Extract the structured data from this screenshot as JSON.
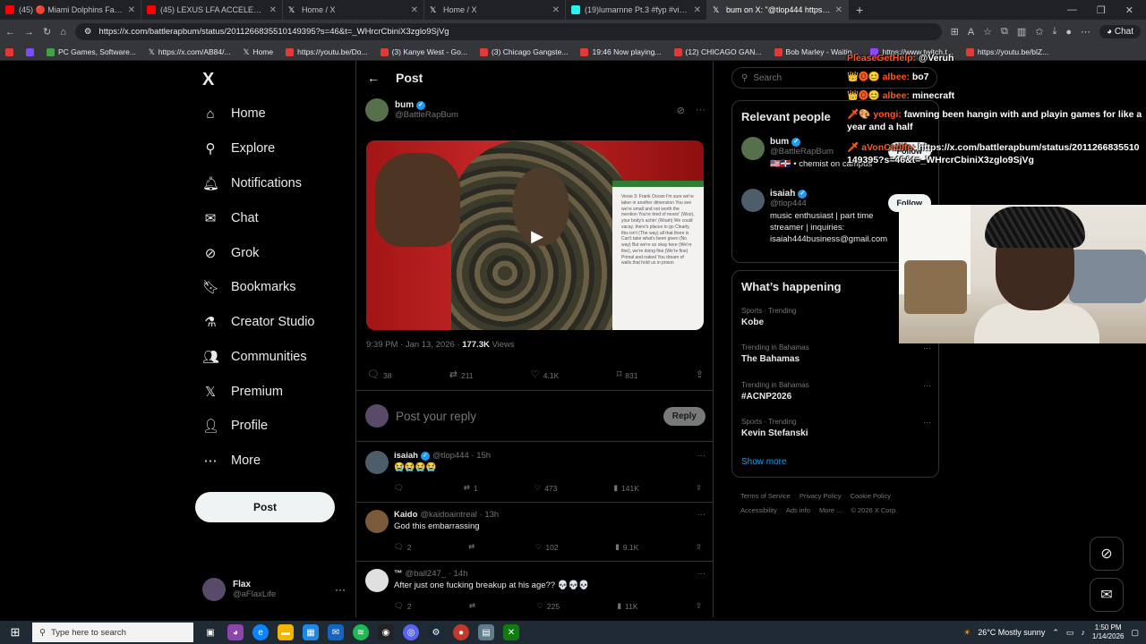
{
  "browser": {
    "tabs": [
      {
        "title": "(45) 🔴 Miami Dolphins Fans Get",
        "icon_color": "#ff0000",
        "active": false
      },
      {
        "title": "(45) LEXUS LFA ACCELERATION !!",
        "icon_color": "#ff0000",
        "active": false
      },
      {
        "title": "Home / X",
        "icon_color": "#ffffff",
        "active": false
      },
      {
        "title": "Home / X",
        "icon_color": "#ffffff",
        "active": false
      },
      {
        "title": "(19)lumarnne Pt.3 #fyp #viral #jun",
        "icon_color": "#25f4ee",
        "active": false
      },
      {
        "title": "bum on X: \"@tlop444 https://t.co",
        "icon_color": "#ffffff",
        "active": true
      }
    ],
    "url": "https://x.com/battlerapbum/status/2011266835510149395?s=46&t=_WHrcrCbiniX3zglo9SjVg",
    "chat_label": "Chat",
    "bookmarks": [
      {
        "label": "",
        "icon_color": "#e53935"
      },
      {
        "label": "",
        "icon_color": "#7c4dff"
      },
      {
        "label": "PC Games, Software...",
        "icon_color": "#43a047"
      },
      {
        "label": "https://x.com/AB84/...",
        "icon_color": "#000000"
      },
      {
        "label": "Home",
        "icon_color": "#000000"
      },
      {
        "label": "https://youtu.be/Do...",
        "icon_color": "#e53935"
      },
      {
        "label": "(3) Kanye West - Go...",
        "icon_color": "#e53935"
      },
      {
        "label": "(3) Chicago Gangste...",
        "icon_color": "#e53935"
      },
      {
        "label": "19:46 Now playing...",
        "icon_color": "#e53935"
      },
      {
        "label": "(12) CHICAGO GAN...",
        "icon_color": "#e53935"
      },
      {
        "label": "Bob Marley - Waitin...",
        "icon_color": "#e53935"
      },
      {
        "label": "https://www.twitch.t...",
        "icon_color": "#9146ff"
      },
      {
        "label": "https://youtu.be/blZ...",
        "icon_color": "#e53935"
      }
    ]
  },
  "sidebar": {
    "logo": "X",
    "nav": [
      {
        "label": "Home",
        "icon": "home-icon",
        "glyph": "⌂"
      },
      {
        "label": "Explore",
        "icon": "search-icon",
        "glyph": "⚲"
      },
      {
        "label": "Notifications",
        "icon": "bell-icon",
        "glyph": "🔔︎"
      },
      {
        "label": "Chat",
        "icon": "mail-icon",
        "glyph": "✉"
      },
      {
        "label": "Grok",
        "icon": "grok-icon",
        "glyph": "⊘"
      },
      {
        "label": "Bookmarks",
        "icon": "bookmark-icon",
        "glyph": "🔖︎"
      },
      {
        "label": "Creator Studio",
        "icon": "flask-icon",
        "glyph": "⚗"
      },
      {
        "label": "Communities",
        "icon": "people-icon",
        "glyph": "👥︎"
      },
      {
        "label": "Premium",
        "icon": "x-premium-icon",
        "glyph": "𝕏"
      },
      {
        "label": "Profile",
        "icon": "person-icon",
        "glyph": "👤︎"
      },
      {
        "label": "More",
        "icon": "more-circle-icon",
        "glyph": "⋯"
      }
    ],
    "post_label": "Post",
    "account": {
      "name": "Flax",
      "handle": "@aFlaxLife"
    }
  },
  "main": {
    "header_title": "Post",
    "author": {
      "name": "bum",
      "handle": "@BattleRapBum"
    },
    "video_text": "Verse 3: Frank Ocean I'm sure we're taker in another dimension You see we're small and not worth the mention You're tired of movin' (Woo), your body's achin' (Woah) We could vacay, there's places to go Clearly, this isn't (The way) all that there is Can't take what's been given (No way) But we're so okay here (We're fine), we're doing fine (We're fine) Primal and naked You dream of walls that hold us in prison",
    "timestamp": "9:39 PM · Jan 13, 2026 · ",
    "views_count": "177.3K",
    "views_label": " Views",
    "actions": {
      "replies": "38",
      "reposts": "211",
      "likes": "4.1K",
      "bookmarks": "831"
    },
    "reply_placeholder": "Post your reply",
    "reply_button": "Reply",
    "replies": [
      {
        "name": "isaiah",
        "verified": true,
        "handle": "@tlop444 · 15h",
        "text": "😭😭😭😭",
        "reply_count": "",
        "repost_count": "1",
        "like_count": "473",
        "view_count": "141K"
      },
      {
        "name": "Kaido",
        "verified": false,
        "handle": "@kaidoaintreal · 13h",
        "text": "God this embarrassing",
        "reply_count": "2",
        "repost_count": "",
        "like_count": "102",
        "view_count": "9.1K"
      },
      {
        "name": "™",
        "verified": false,
        "handle": "@ball247_ · 14h",
        "text": "After just one fucking breakup at his age?? 💀💀💀",
        "reply_count": "2",
        "repost_count": "",
        "like_count": "225",
        "view_count": "11K"
      }
    ]
  },
  "right": {
    "search_placeholder": "Search",
    "relevant_title": "Relevant people",
    "people": [
      {
        "name": "bum",
        "handle": "@BattleRapBum",
        "bio": "🇺🇸🇩🇴 • chemist on campus",
        "follow": "Follow"
      },
      {
        "name": "isaiah",
        "handle": "@tlop444",
        "bio": "music enthusiast | part time streamer | inquiries: isaiah444business@gmail.com",
        "follow": "Follow"
      }
    ],
    "happening_title": "What’s happening",
    "trends": [
      {
        "category": "Sports · Trending",
        "name": "Kobe"
      },
      {
        "category": "Trending in Bahamas",
        "name": "The Bahamas"
      },
      {
        "category": "Trending in Bahamas",
        "name": "#ACNP2026"
      },
      {
        "category": "Sports · Trending",
        "name": "Kevin Stefanski"
      }
    ],
    "show_more": "Show more",
    "footer": [
      "Terms of Service",
      "Privacy Policy",
      "Cookie Policy",
      "Accessibility",
      "Ads info",
      "More ...",
      "© 2026 X Corp."
    ]
  },
  "stream_chat": [
    {
      "user": "PleaseGetHelp:",
      "text": " @Veruh"
    },
    {
      "user": "👑🅞😊 albee:",
      "text": " bo7"
    },
    {
      "user": "👑🅞😊 albee:",
      "text": " minecraft"
    },
    {
      "user": "🗡🎨 yongi:",
      "text": " fawning been hangin with and playin games for like a year and a half"
    },
    {
      "user": "🗡 aVonCatlife:",
      "text": " https://x.com/battlerapbum/status/2011266835510149395?s=46&t=_WHrcrCbiniX3zglo9SjVg"
    }
  ],
  "taskbar": {
    "search_placeholder": "Type here to search",
    "weather": "26°C  Mostly sunny",
    "time": "1:50 PM",
    "date": "1/14/2026"
  }
}
